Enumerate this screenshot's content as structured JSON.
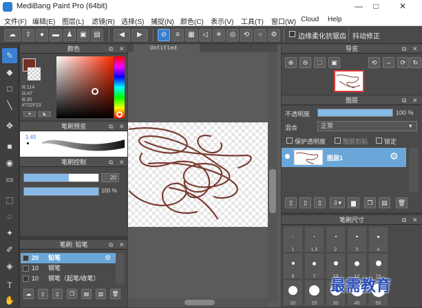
{
  "window": {
    "title": "MediBang Paint Pro (64bit)",
    "minimize": "—",
    "maximize": "□",
    "close": "✕"
  },
  "menu": [
    "文件(F)",
    "编辑(E)",
    "图层(L)",
    "滤镜(R)",
    "选择(S)",
    "捕捉(N)",
    "颜色(C)",
    "表示(V)",
    "工具(T)",
    "窗口(W)",
    "Cloud",
    "Help"
  ],
  "toolbar": {
    "antialias_label": "边缘柔化抗锯齿",
    "stabilizer_label": "抖动修正"
  },
  "color_panel": {
    "title": "颜色",
    "r": "R:114",
    "g": "G:47",
    "b": "B:35",
    "hex": "#722F23",
    "primary": "#722f23"
  },
  "brush_preview": {
    "title": "笔刷预览",
    "size": "1.45"
  },
  "brush_control": {
    "title": "笔刷控制",
    "size_value": "20",
    "opacity_value": "100 %",
    "size_fill": 0.6,
    "opacity_fill": 1.0
  },
  "brush_list": {
    "title": "笔刷: 铅笔",
    "items": [
      {
        "size": "20",
        "name": "铅笔"
      },
      {
        "size": "10",
        "name": "钢笔"
      },
      {
        "size": "10",
        "name": "钢笔（起笔/收笔）"
      }
    ]
  },
  "canvas": {
    "tab": "Untitled",
    "stroke_color": "#7a3d33"
  },
  "navigator": {
    "title": "导览"
  },
  "layer_panel": {
    "title": "图层",
    "opacity_label": "不透明度",
    "opacity_value": "100 %",
    "blend_label": "混合",
    "blend_value": "正常",
    "protect_alpha": "保护透明度",
    "clipping": "图层剪贴",
    "lock": "锁定",
    "layer_name": "图层1"
  },
  "brush_size_panel": {
    "title": "笔刷尺寸",
    "sizes": [
      "1",
      "1.5",
      "2",
      "3",
      "4",
      "5",
      "7",
      "10",
      "12",
      "15",
      "20",
      "25",
      "30",
      "40",
      "50"
    ]
  },
  "watermark": "最需教育"
}
